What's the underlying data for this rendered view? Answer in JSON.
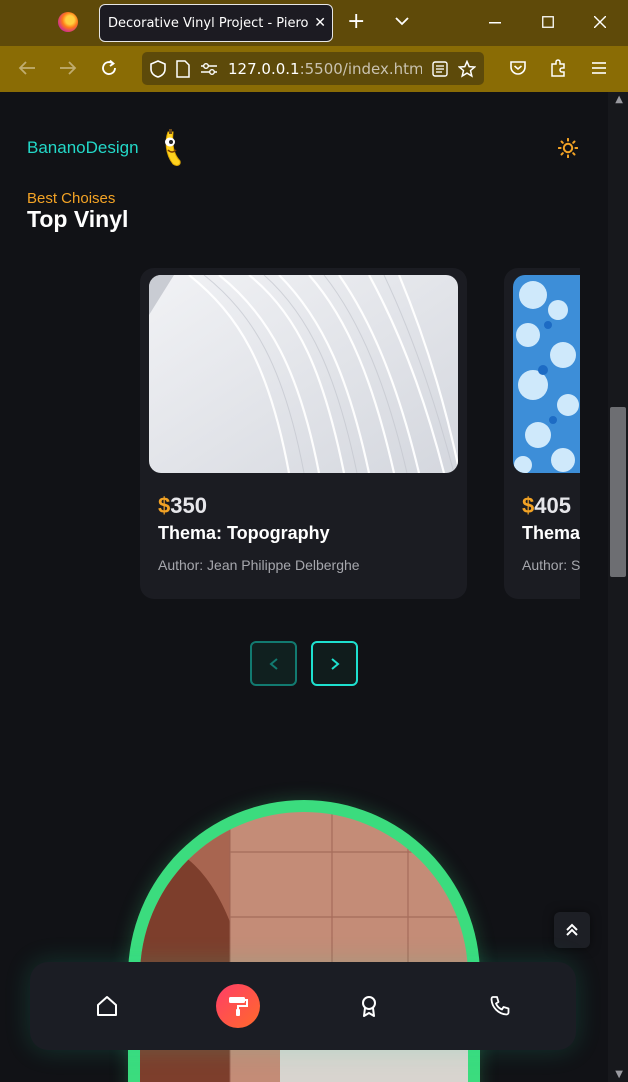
{
  "browser": {
    "tab_title": "Decorative Vinyl Project - Piero Bi",
    "url_host": "127.0.0.1",
    "url_rest": ":5500/index.htm"
  },
  "header": {
    "logo_text": "BananoDesign",
    "theme_icon": "sun-icon"
  },
  "section": {
    "eyebrow": "Best Choises",
    "title": "Top Vinyl"
  },
  "cards": [
    {
      "currency": "$",
      "price": "350",
      "theme": "Thema: Topography",
      "author": "Author: Jean Philippe Delberghe"
    },
    {
      "currency": "$",
      "price": "405",
      "theme": "Thema: Frost",
      "author": "Author: S"
    }
  ],
  "carousel_controls": {
    "prev_icon": "chevron-left-icon",
    "next_icon": "chevron-right-icon"
  },
  "bottom_nav": {
    "items": [
      "home-icon",
      "paint-roller-icon",
      "award-icon",
      "phone-icon"
    ],
    "active_index": 1
  },
  "colors": {
    "accent_teal": "#23d8c8",
    "accent_orange": "#f3a325",
    "arch_green": "#3bdc7e",
    "active_gradient": "#ff3d68"
  }
}
